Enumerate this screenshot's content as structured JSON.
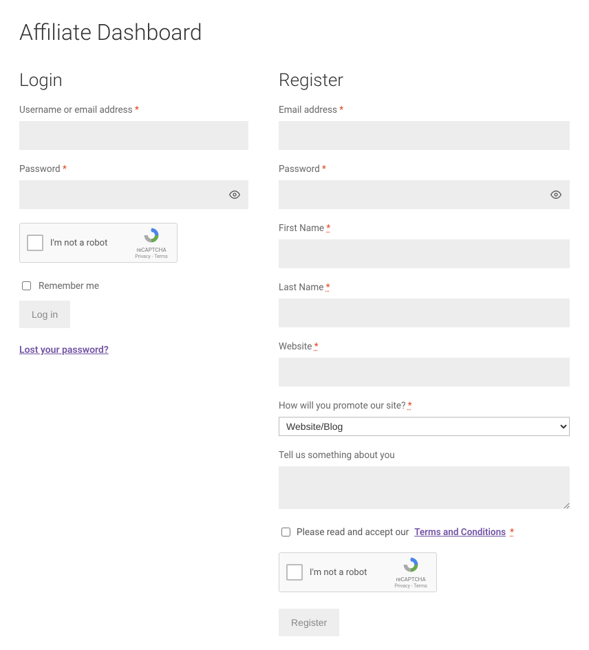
{
  "page_title": "Affiliate Dashboard",
  "login": {
    "heading": "Login",
    "username_label": "Username or email address ",
    "password_label": "Password ",
    "recaptcha_label": "I'm not a robot",
    "recaptcha_brand": "reCAPTCHA",
    "recaptcha_legal": "Privacy - Terms",
    "remember_label": "Remember me",
    "submit_label": "Log in",
    "lost_password": "Lost your password?"
  },
  "register": {
    "heading": "Register",
    "email_label": "Email address ",
    "password_label": "Password ",
    "first_name_label": "First Name ",
    "last_name_label": "Last Name ",
    "website_label": "Website ",
    "promote_label": "How will you promote our site? ",
    "promote_value": "Website/Blog",
    "about_label": "Tell us something about you",
    "terms_prefix": "Please read and accept our ",
    "terms_link": "Terms and Conditions",
    "recaptcha_label": "I'm not a robot",
    "recaptcha_brand": "reCAPTCHA",
    "recaptcha_legal": "Privacy - Terms",
    "submit_label": "Register"
  },
  "required": "*"
}
